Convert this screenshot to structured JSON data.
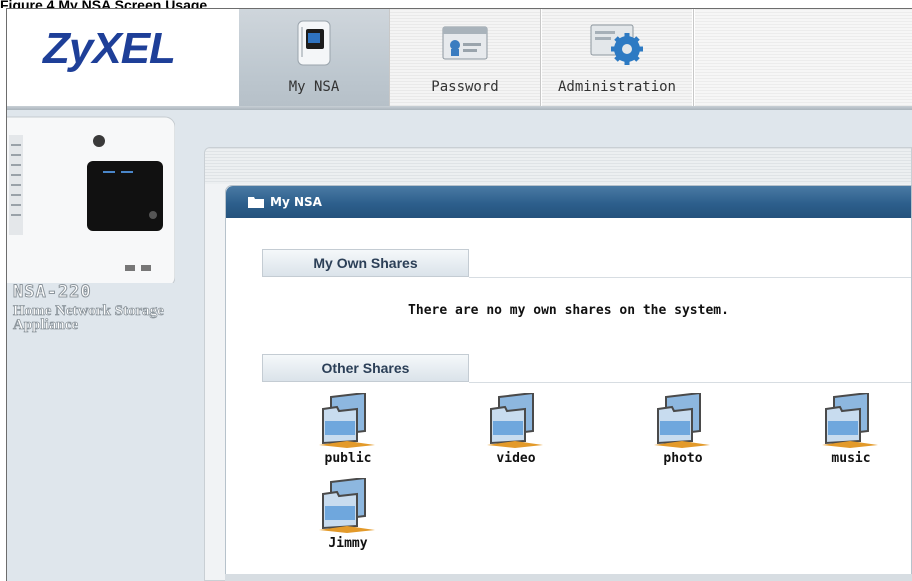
{
  "figure_caption": "Figure 4 My NSA Screen Usage",
  "header": {
    "logo": "ZyXEL",
    "tabs": [
      {
        "label": "My NSA",
        "icon": "device-icon",
        "active": true
      },
      {
        "label": "Password",
        "icon": "password-card-icon",
        "active": false
      },
      {
        "label": "Administration",
        "icon": "admin-gear-icon",
        "active": false
      }
    ]
  },
  "device": {
    "model": "NSA-220",
    "description": "Home Network Storage Appliance"
  },
  "window": {
    "title": "My NSA",
    "my_own_shares": {
      "heading": "My Own Shares",
      "empty_message": "There are no my own shares on the system."
    },
    "other_shares": {
      "heading": "Other Shares",
      "items": [
        "public",
        "video",
        "photo",
        "music",
        "Jimmy"
      ]
    }
  },
  "colors": {
    "logo": "#1e3f98",
    "title_bar": "#2d5f8c",
    "section_text": "#2b3f57"
  }
}
